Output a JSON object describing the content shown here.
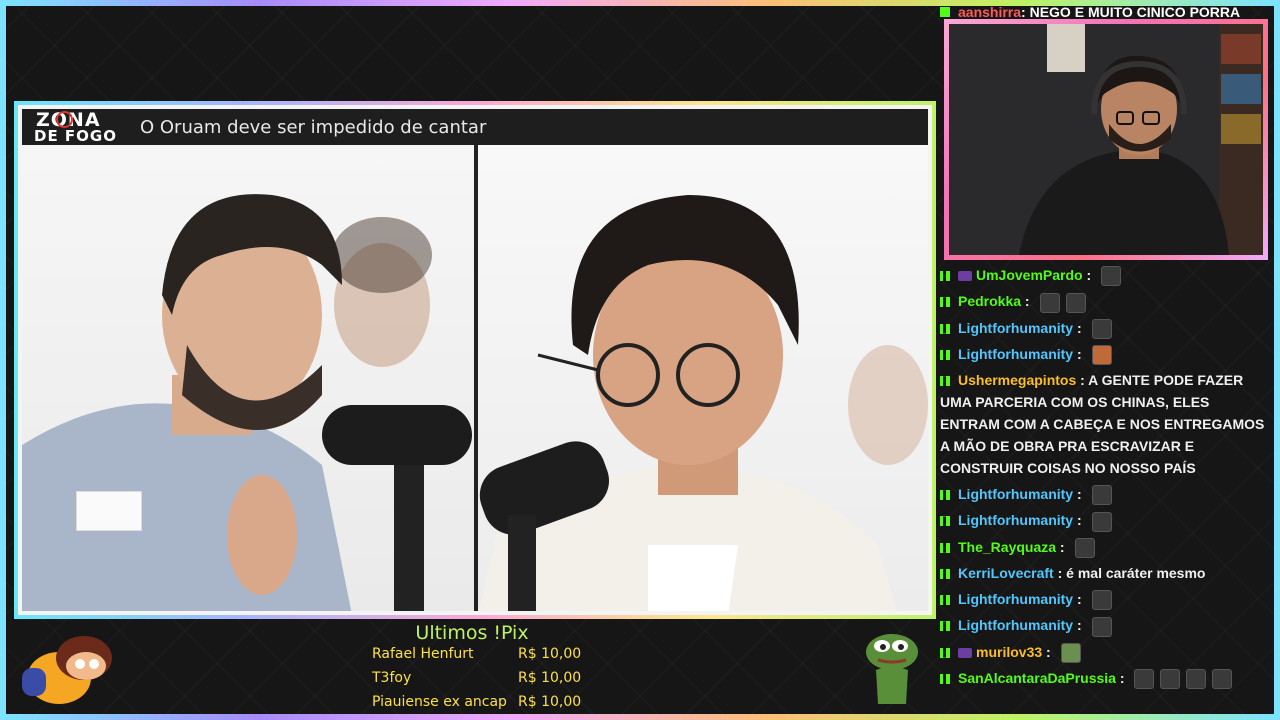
{
  "stream": {
    "title_logo_line1": "ZONA",
    "title_logo_line2": "DE FOGO",
    "video_title": "O Oruam deve ser impedido de cantar"
  },
  "top_message": {
    "username": "aanshirra",
    "text": ": NEGO E MUITO CINICO PORRA"
  },
  "chat": [
    {
      "username": "UmJovemPardo",
      "color": "#53fc18",
      "badge": true,
      "text": "",
      "emotes": [
        "emote"
      ]
    },
    {
      "username": "Pedrokka",
      "color": "#53fc18",
      "text": "",
      "emotes": [
        "emote",
        "emote"
      ]
    },
    {
      "username": "Lightforhumanity",
      "color": "#53c6fc",
      "text": "",
      "emotes": [
        "emote"
      ]
    },
    {
      "username": "Lightforhumanity",
      "color": "#53c6fc",
      "text": "",
      "emotes": [
        "face"
      ]
    },
    {
      "username": "Ushermegapintos",
      "color": "#fbbf24",
      "text": "A GENTE PODE FAZER UMA PARCERIA COM OS CHINAS, ELES ENTRAM COM A CABEÇA E NOS ENTREGAMOS A MÃO DE OBRA PRA ESCRAVIZAR E CONSTRUIR COISAS NO NOSSO PAÍS",
      "emotes": []
    },
    {
      "username": "Lightforhumanity",
      "color": "#53c6fc",
      "text": "",
      "emotes": [
        "emote"
      ]
    },
    {
      "username": "Lightforhumanity",
      "color": "#53c6fc",
      "text": "",
      "emotes": [
        "emote"
      ]
    },
    {
      "username": "The_Rayquaza",
      "color": "#53fc18",
      "text": "",
      "emotes": [
        "emote"
      ]
    },
    {
      "username": "KerriLovecraft",
      "color": "#53c6fc",
      "text": "é mal caráter mesmo",
      "emotes": []
    },
    {
      "username": "Lightforhumanity",
      "color": "#53c6fc",
      "text": "",
      "emotes": [
        "emote"
      ]
    },
    {
      "username": "Lightforhumanity",
      "color": "#53c6fc",
      "text": "",
      "emotes": [
        "emote"
      ]
    },
    {
      "username": "murilov33",
      "color": "#fbbf24",
      "badge": true,
      "text": "",
      "emotes": [
        "frog"
      ]
    },
    {
      "username": "SanAlcantaraDaPrussia",
      "color": "#53fc18",
      "text": "",
      "emotes": [
        "emote",
        "emote",
        "emote",
        "emote"
      ]
    }
  ],
  "pix": {
    "title": "Ultimos !Pix",
    "rows": [
      {
        "name": "Rafael Henfurt",
        "amount": "R$ 10,00"
      },
      {
        "name": "T3foy",
        "amount": "R$ 10,00"
      },
      {
        "name": "Piauiense ex ancap",
        "amount": "R$ 10,00"
      }
    ]
  },
  "colors": {
    "kick_green": "#53fc18",
    "pix_title": "#bef264",
    "pix_text": "#fde047",
    "top_user": "#ff5a5a"
  }
}
